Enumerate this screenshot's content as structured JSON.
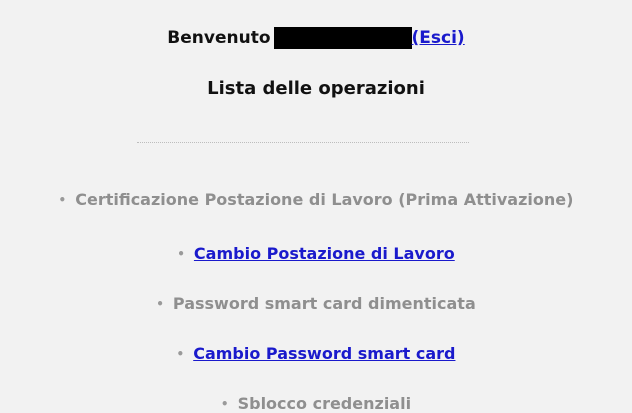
{
  "header": {
    "welcome_label": "Benvenuto",
    "logout_label": "(Esci)"
  },
  "main": {
    "title": "Lista delle operazioni",
    "operations": [
      {
        "label": "Certificazione Postazione di Lavoro (Prima Attivazione)",
        "is_link": false
      },
      {
        "label": "Cambio Postazione di Lavoro",
        "is_link": true
      },
      {
        "label": "Password smart card dimenticata",
        "is_link": false
      },
      {
        "label": "Cambio Password smart card",
        "is_link": true
      },
      {
        "label": "Sblocco credenziali",
        "is_link": false
      }
    ]
  },
  "colors": {
    "background": "#f2f2f2",
    "link": "#1a1acc",
    "disabled_text": "#8f8f8f",
    "heading_text": "#111111"
  },
  "bullet_glyph": "•"
}
